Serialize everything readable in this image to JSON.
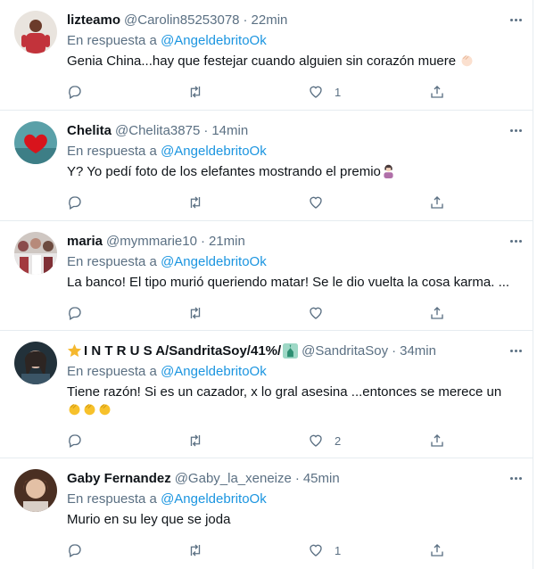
{
  "reply_prefix": "En respuesta a",
  "tweets": [
    {
      "name": "lizteamo",
      "handle": "@Carolin85253078",
      "separator": "·",
      "time": "22min",
      "reply_to": "@AngeldebritoOk",
      "text": "Genia China...hay que festejar cuando alguien sin corazón muere",
      "emoji": "clapping-hands",
      "reply_count": "",
      "retweet_count": "",
      "like_count": "1"
    },
    {
      "name": "Chelita",
      "handle": "@Chelita3875",
      "separator": "·",
      "time": "14min",
      "reply_to": "@AngeldebritoOk",
      "text": "Y? Yo pedí foto de los elefantes mostrando el premio",
      "emoji": "person-tipping-hand",
      "reply_count": "",
      "retweet_count": "",
      "like_count": ""
    },
    {
      "name": "maria",
      "handle": "@mymmarie10",
      "separator": "·",
      "time": "21min",
      "reply_to": "@AngeldebritoOk",
      "text": "La banco! El tipo murió queriendo matar! Se le dio vuelta la cosa karma. ...",
      "reply_count": "",
      "retweet_count": "",
      "like_count": ""
    },
    {
      "name": "I N T R U S A/SandritaSoy/41%/",
      "handle": "@SandritaSoy",
      "separator": "·",
      "time": "34min",
      "reply_to": "@AngeldebritoOk",
      "text": "Tiene razón! Si es un cazador, x lo gral asesina ...entonces se merece un",
      "emoji": "clapping-hands x3",
      "reply_count": "",
      "retweet_count": "",
      "like_count": "2"
    },
    {
      "name": "Gaby Fernandez",
      "handle": "@Gaby_la_xeneize",
      "separator": "·",
      "time": "45min",
      "reply_to": "@AngeldebritoOk",
      "text": "Murio en su ley que se joda",
      "reply_count": "",
      "retweet_count": "",
      "like_count": "1"
    }
  ],
  "icons": {
    "reply": "reply-icon",
    "retweet": "retweet-icon",
    "like": "heart-icon",
    "share": "share-icon",
    "more": "more-icon"
  },
  "colors": {
    "link": "#1b95e0",
    "secondary_text": "#5b7083",
    "divider": "#e6ecf0"
  }
}
